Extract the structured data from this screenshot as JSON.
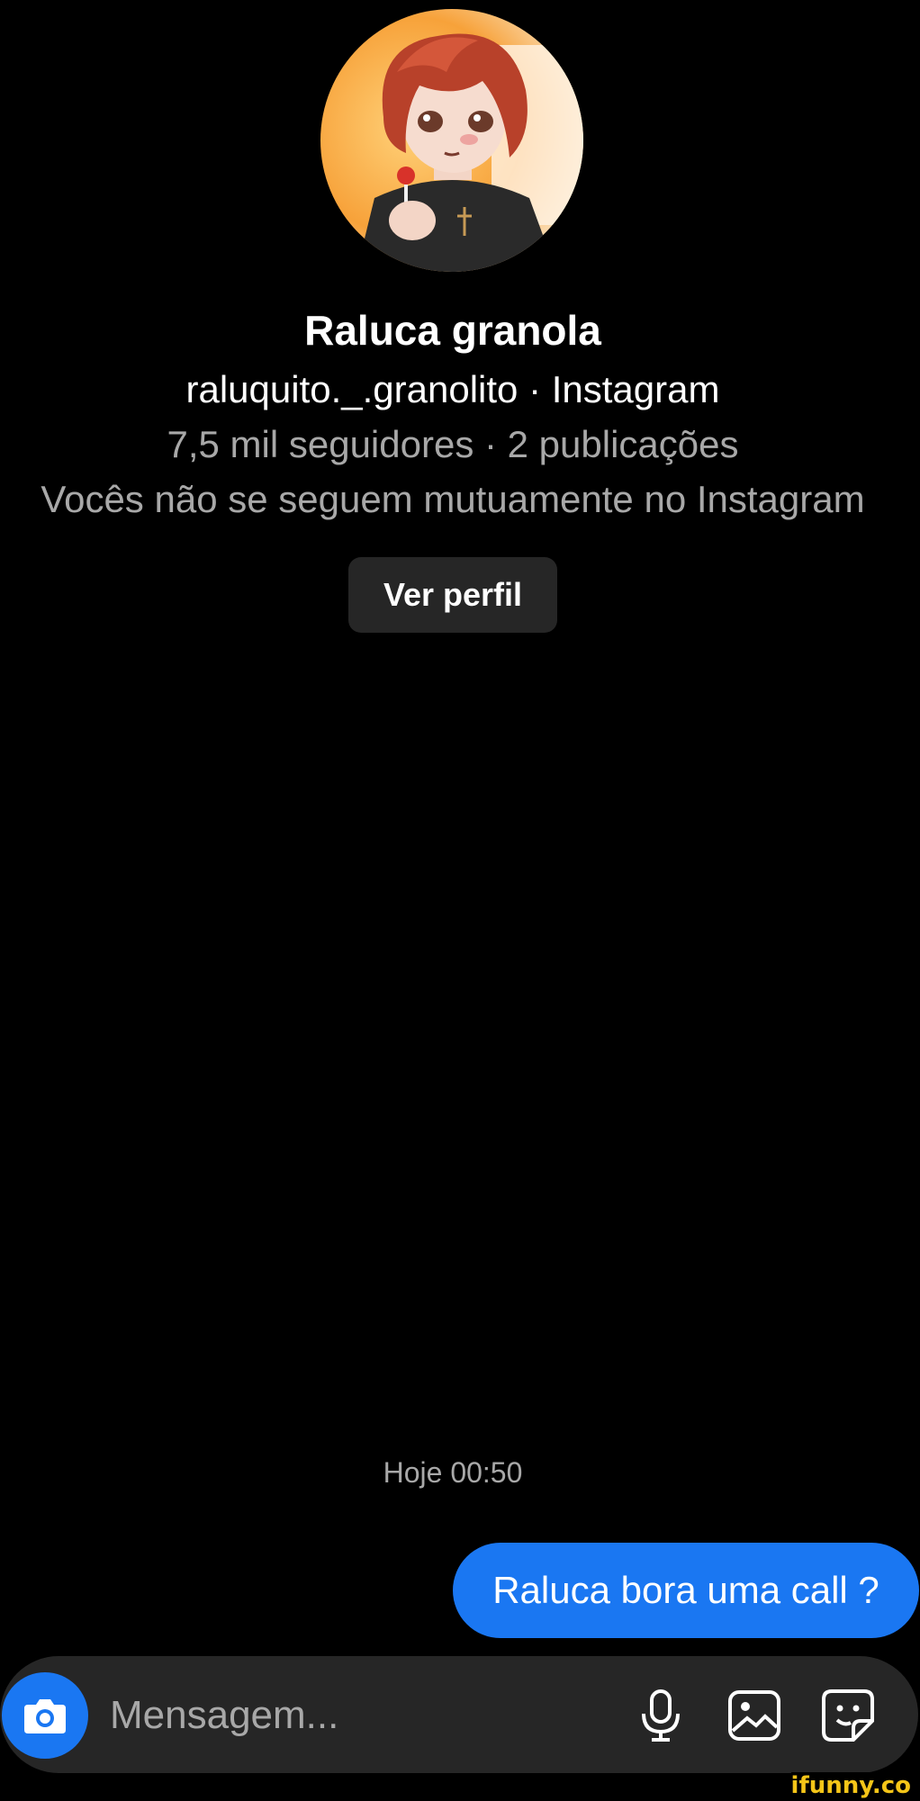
{
  "profile": {
    "name": "Raluca granola",
    "handle_line": "raluquito._.granolito · Instagram",
    "stats_line": "7,5 mil seguidores · 2 publicações",
    "mutual_line": "Vocês não se seguem mutuamente no Instagram",
    "view_profile_label": "Ver perfil"
  },
  "chat": {
    "timestamp": "Hoje 00:50",
    "messages": [
      {
        "from": "me",
        "text": "Raluca bora uma call ?"
      }
    ]
  },
  "composer": {
    "placeholder": "Mensagem...",
    "icons": [
      "camera-icon",
      "microphone-icon",
      "gallery-icon",
      "sticker-icon"
    ]
  },
  "watermark": "ifunny.co",
  "colors": {
    "background": "#000000",
    "bubble": "#1a77f2",
    "surface": "#262626",
    "secondary_text": "#a8a8a8"
  }
}
